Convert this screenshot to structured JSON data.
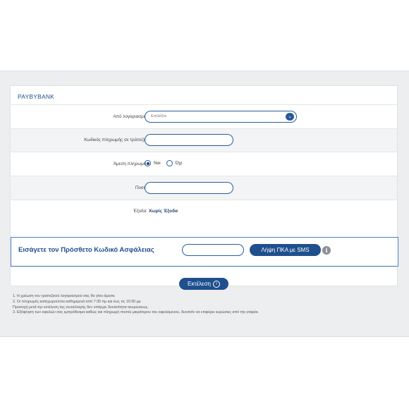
{
  "brand": "PAYBYBANK",
  "form": {
    "from_account_label": "Από λογαριασμό:",
    "from_account_placeholder": "Επιλέξτε",
    "payment_code_label": "Κωδικός πληρωμής σε τράπεζα:",
    "instant_label": "Άμεση πληρωμή:",
    "instant_options": [
      "Ναι",
      "Όχι"
    ],
    "instant_selected": "Ναι",
    "amount_label": "Ποσό:",
    "expenses_label": "Έξοδα:",
    "expenses_value": "Χωρίς Έξοδα"
  },
  "pka": {
    "title": "Εισάγετε τον Πρόσθετο Κωδικό Ασφάλειας",
    "sms_button": "Λήψη ΠΚΑ με SMS",
    "info_icon": "i"
  },
  "execute_button": "Εκτέλεση",
  "footnotes": [
    "1. Η χρέωση του τραπεζικού λογαριασμού σας θα γίνει άμεσα.",
    "2. Οι πληρωμές καταχωρούνται καθημερινά από 7:30 πμ και έως τις 10:30 μμ",
    "Προσοχή μετά την εκτέλεση της συναλλαγής δεν υπάρχει δυνατότητα ακυρώσεως.",
    "3. Εξόφληση των οφειλών σας εμπρόθεσμα καθώς και πληρωμή ποσού μικρότερου του οφειλόμενου, δυνατόν να επιφέρει κυρώσεις από την εταιρία."
  ],
  "colors": {
    "accent": "#1f4f8d",
    "page_bg": "#eceeef"
  }
}
